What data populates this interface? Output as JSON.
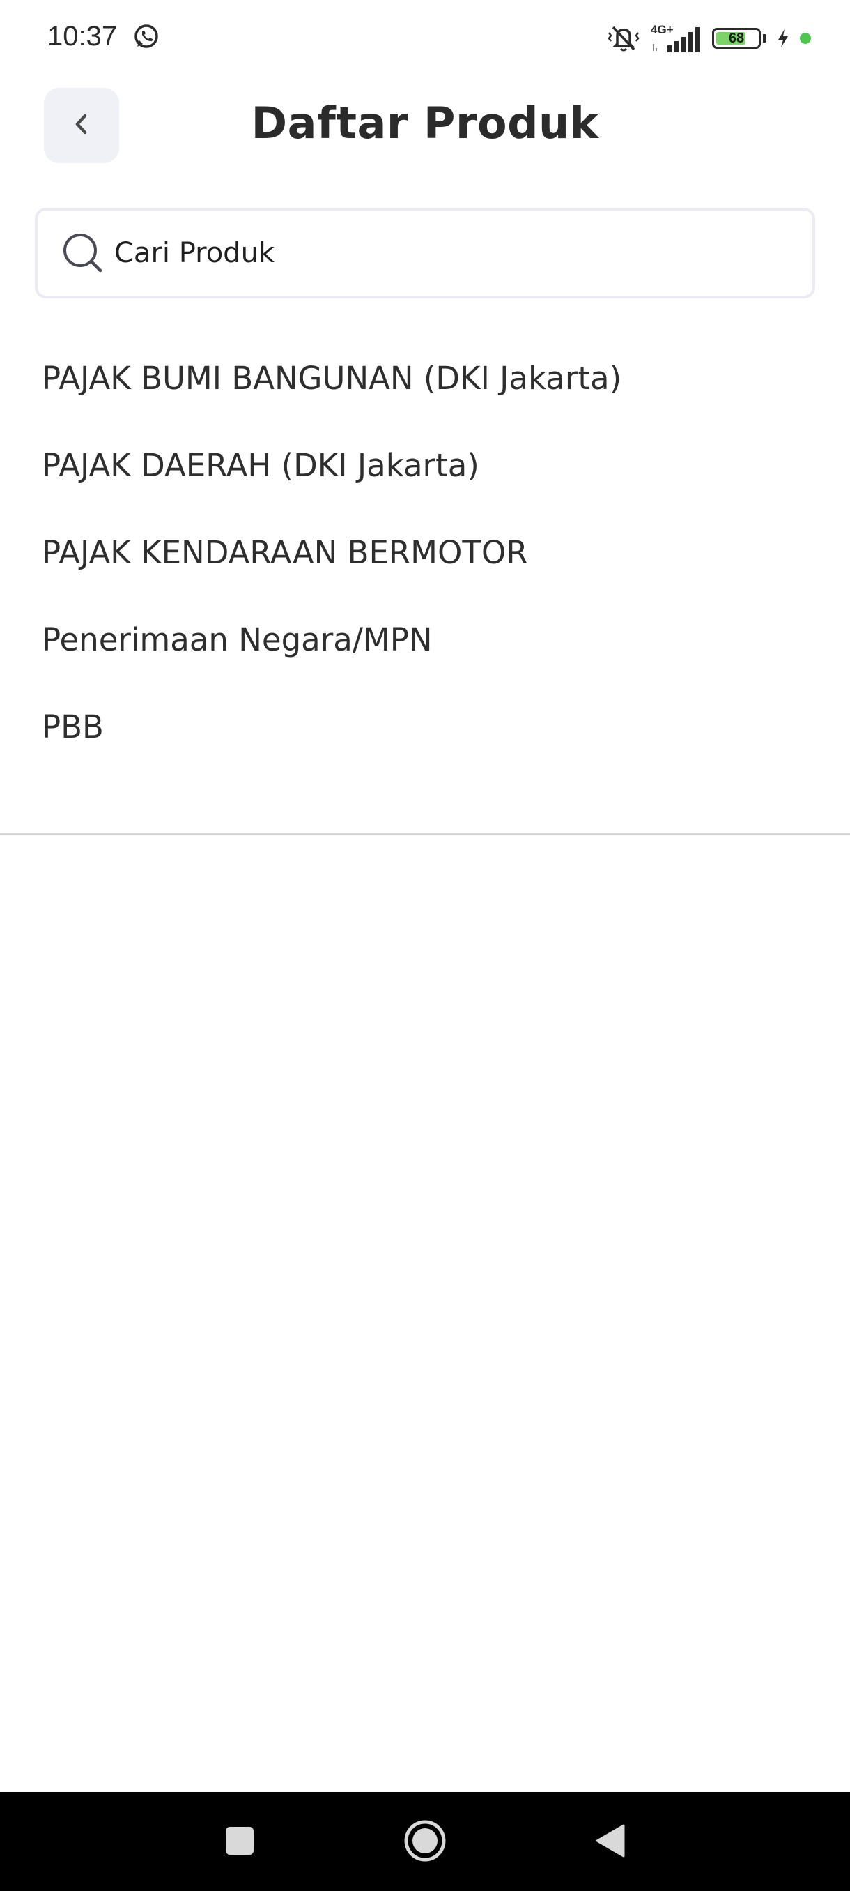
{
  "status_bar": {
    "time": "10:37",
    "network": "4G+",
    "battery": "68",
    "icons": [
      "whatsapp-icon",
      "silent-vibrate-icon",
      "signal-icon",
      "battery-icon",
      "charging-icon",
      "green-dot-icon"
    ]
  },
  "header": {
    "title": "Daftar Produk",
    "back_icon": "chevron-left-icon"
  },
  "search": {
    "placeholder": "Cari Produk",
    "value": "",
    "icon": "search-icon"
  },
  "products": [
    {
      "label": "PAJAK BUMI BANGUNAN (DKI Jakarta)"
    },
    {
      "label": "PAJAK DAERAH (DKI Jakarta)"
    },
    {
      "label": "PAJAK KENDARAAN BERMOTOR"
    },
    {
      "label": "Penerimaan Negara/MPN"
    },
    {
      "label": "PBB"
    }
  ],
  "nav_bar": {
    "icons": [
      "recents-square-icon",
      "home-circle-icon",
      "back-triangle-icon"
    ]
  },
  "colors": {
    "accent_battery": "#7bd36a",
    "status_dot": "#4fc64f",
    "back_button_bg": "#f0f1f6",
    "search_border": "#ecebf4"
  }
}
